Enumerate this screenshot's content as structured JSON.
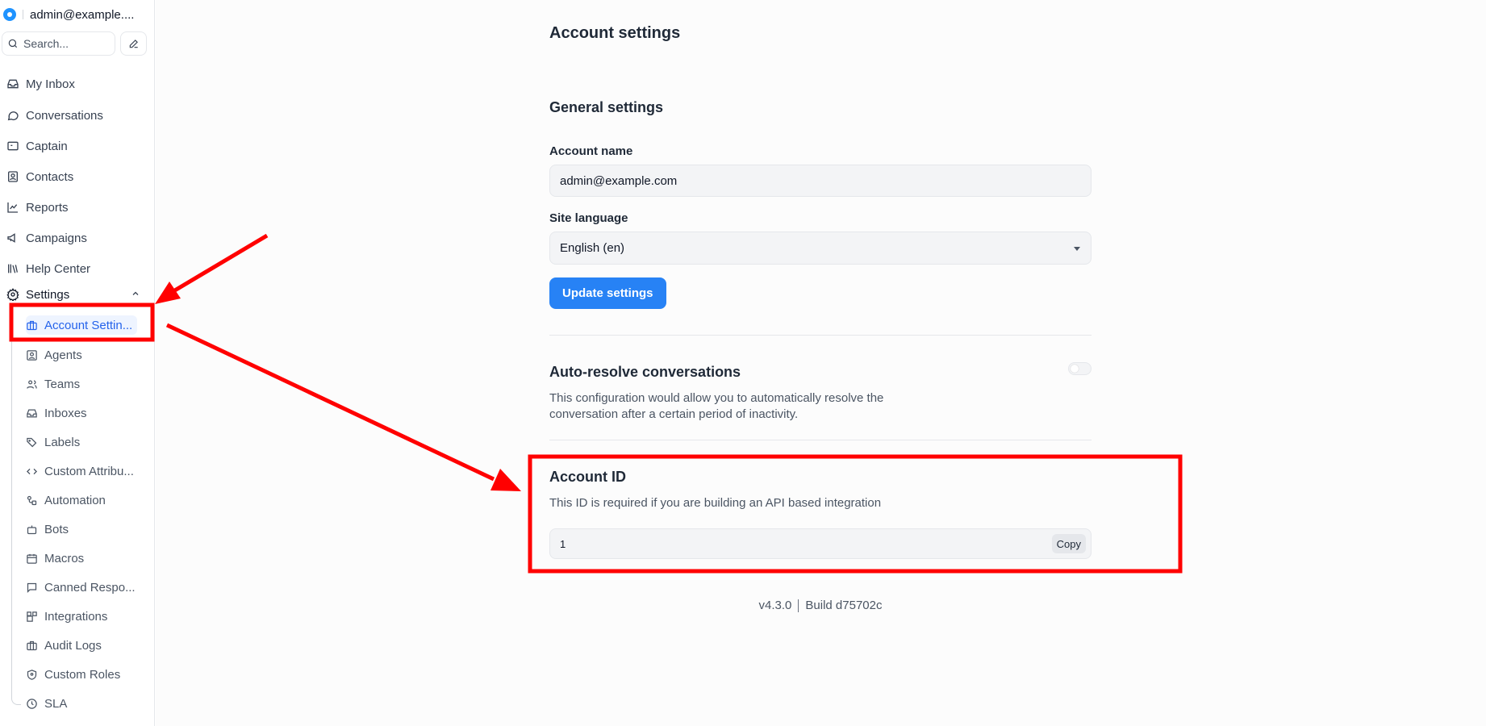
{
  "sidebar": {
    "account_name": "admin@example....",
    "search_placeholder": "Search...",
    "items": [
      {
        "label": "My Inbox",
        "icon": "inbox-icon"
      },
      {
        "label": "Conversations",
        "icon": "chat-bubble-icon"
      },
      {
        "label": "Captain",
        "icon": "captain-icon"
      },
      {
        "label": "Contacts",
        "icon": "contact-card-icon"
      },
      {
        "label": "Reports",
        "icon": "line-chart-icon"
      },
      {
        "label": "Campaigns",
        "icon": "megaphone-icon"
      },
      {
        "label": "Help Center",
        "icon": "library-icon"
      },
      {
        "label": "Settings",
        "icon": "gear-icon"
      }
    ],
    "settings_sub": [
      {
        "label": "Account Settin...",
        "icon": "briefcase-icon",
        "active": true
      },
      {
        "label": "Agents",
        "icon": "person-square-icon"
      },
      {
        "label": "Teams",
        "icon": "people-icon"
      },
      {
        "label": "Inboxes",
        "icon": "inbox-icon"
      },
      {
        "label": "Labels",
        "icon": "tags-icon"
      },
      {
        "label": "Custom Attribu...",
        "icon": "code-icon"
      },
      {
        "label": "Automation",
        "icon": "automation-icon"
      },
      {
        "label": "Bots",
        "icon": "bot-icon"
      },
      {
        "label": "Macros",
        "icon": "calendar-icon"
      },
      {
        "label": "Canned Respo...",
        "icon": "message-square-icon"
      },
      {
        "label": "Integrations",
        "icon": "integrations-icon"
      },
      {
        "label": "Audit Logs",
        "icon": "briefcase-icon"
      },
      {
        "label": "Custom Roles",
        "icon": "shield-icon"
      },
      {
        "label": "SLA",
        "icon": "clock-icon"
      }
    ]
  },
  "main": {
    "page_title": "Account settings",
    "general": {
      "title": "General settings",
      "account_name_label": "Account name",
      "account_name_value": "admin@example.com",
      "language_label": "Site language",
      "language_value": "English (en)",
      "update_button": "Update settings"
    },
    "auto_resolve": {
      "title": "Auto-resolve conversations",
      "desc_line1": "This configuration would allow you to automatically resolve the",
      "desc_line2": "conversation after a certain period of inactivity.",
      "enabled": false
    },
    "account_id": {
      "title": "Account ID",
      "desc": "This ID is required if you are building an API based integration",
      "value": "1",
      "copy_button": "Copy"
    },
    "version": "v4.3.0",
    "build": "Build d75702c"
  },
  "colors": {
    "accent": "#2782f5",
    "annotation": "#ff0000",
    "active_nav": "#2563eb"
  }
}
